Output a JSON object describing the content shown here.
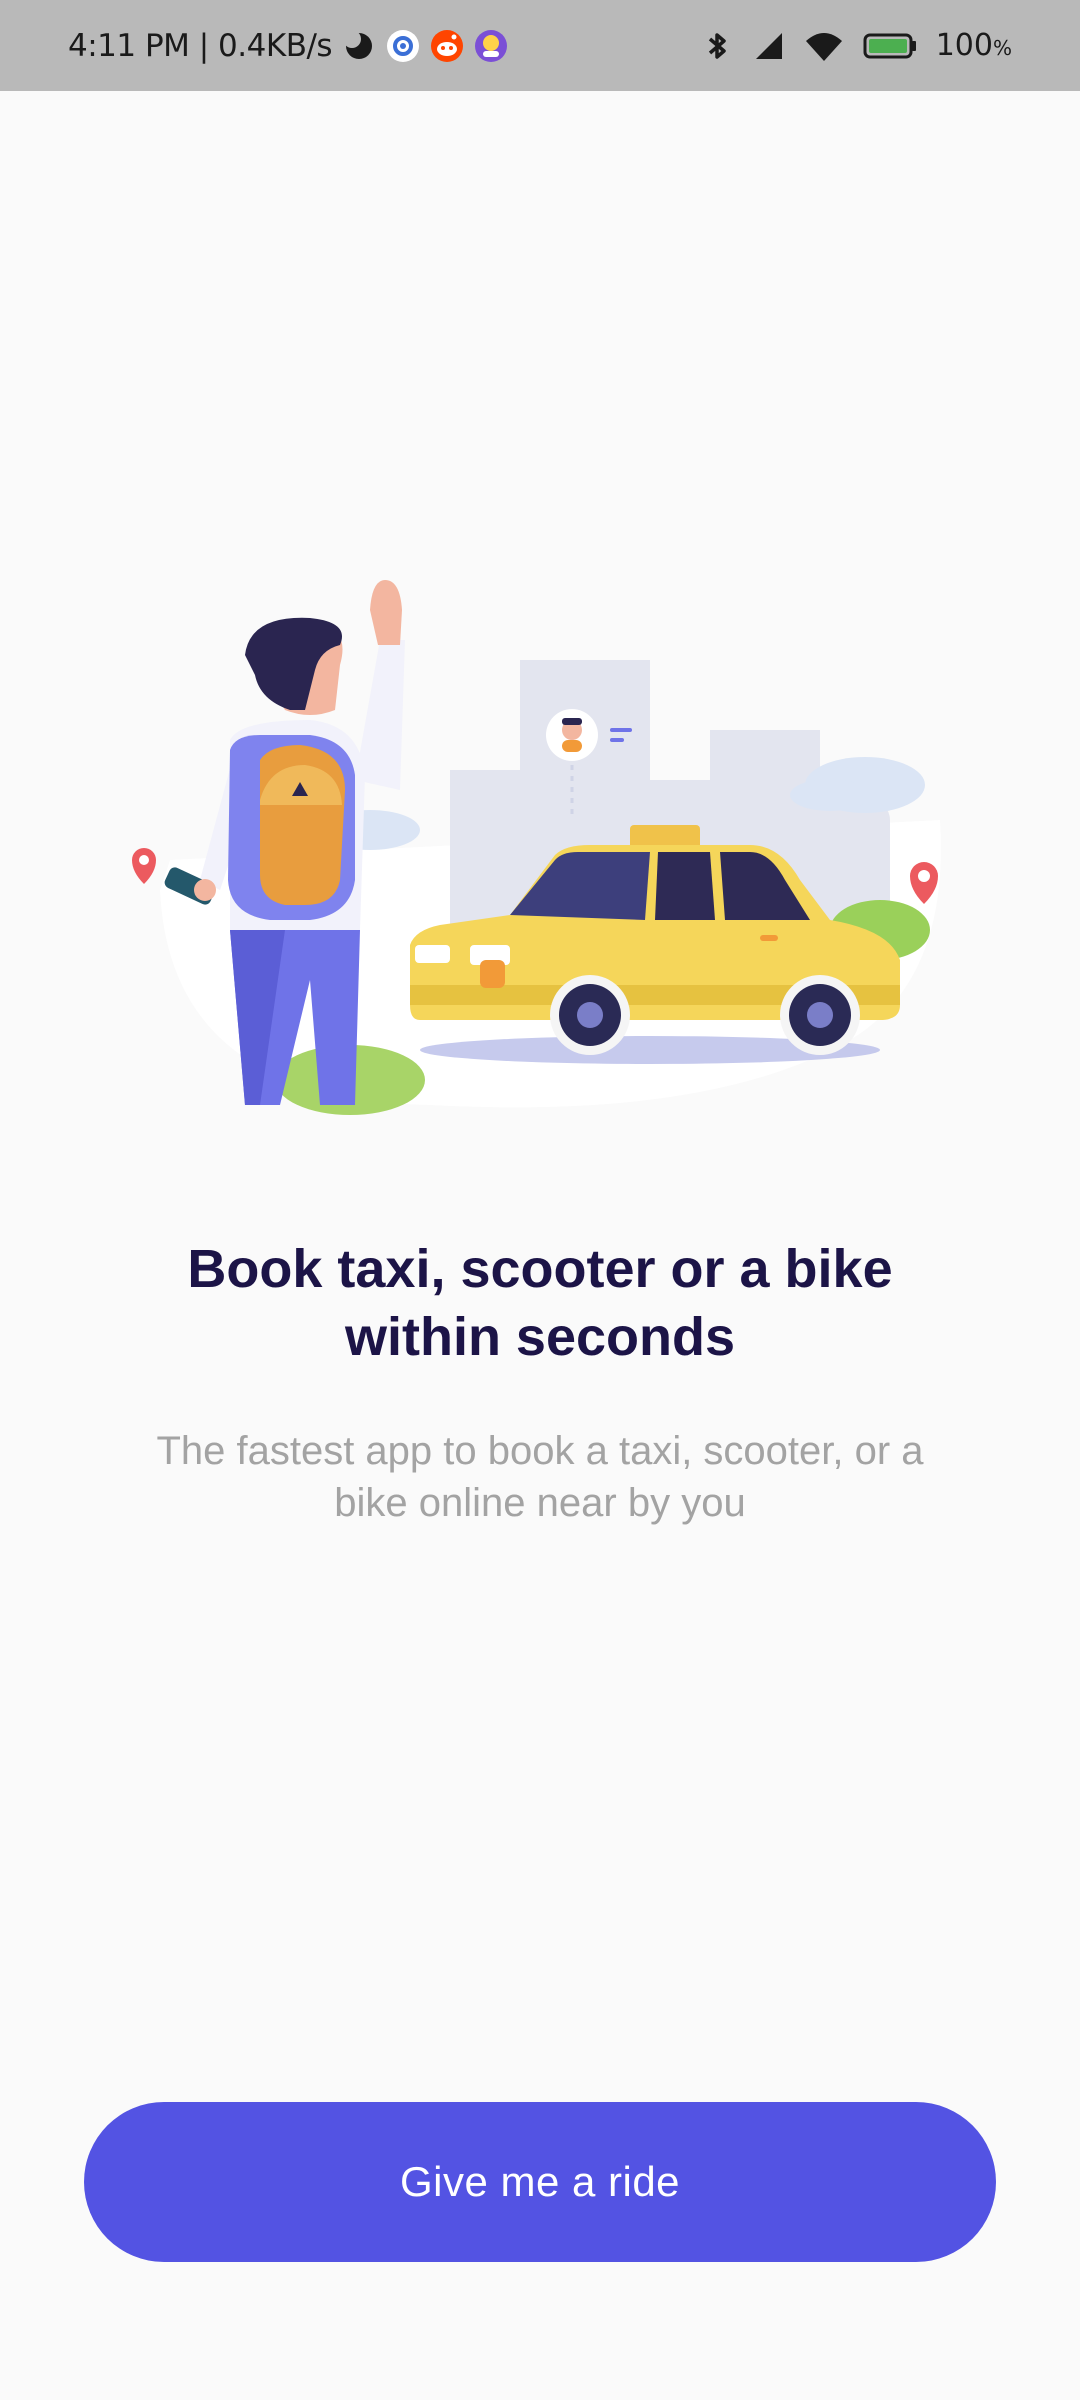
{
  "status_bar": {
    "time_speed": "4:11 PM | 0.4KB/s",
    "battery_pct": "100",
    "battery_suffix": "%",
    "icons": [
      "moon-icon",
      "settings-app-icon",
      "reddit-icon",
      "game-app-icon",
      "bluetooth-icon",
      "signal-icon",
      "wifi-icon",
      "battery-icon"
    ]
  },
  "onboarding": {
    "illustration": "man-hailing-taxi-illustration",
    "headline_line1": "Book taxi, scooter or a bike",
    "headline_line2": "within seconds",
    "subtext_line1": "The fastest app to book a taxi, scooter, or a",
    "subtext_line2": "bike online near by you",
    "cta_label": "Give me a ride"
  },
  "colors": {
    "accent": "#5353e3",
    "headline": "#1c1447",
    "subtext": "#a3a3a3",
    "taxi_yellow": "#f5d65a",
    "background": "#fafafa"
  }
}
